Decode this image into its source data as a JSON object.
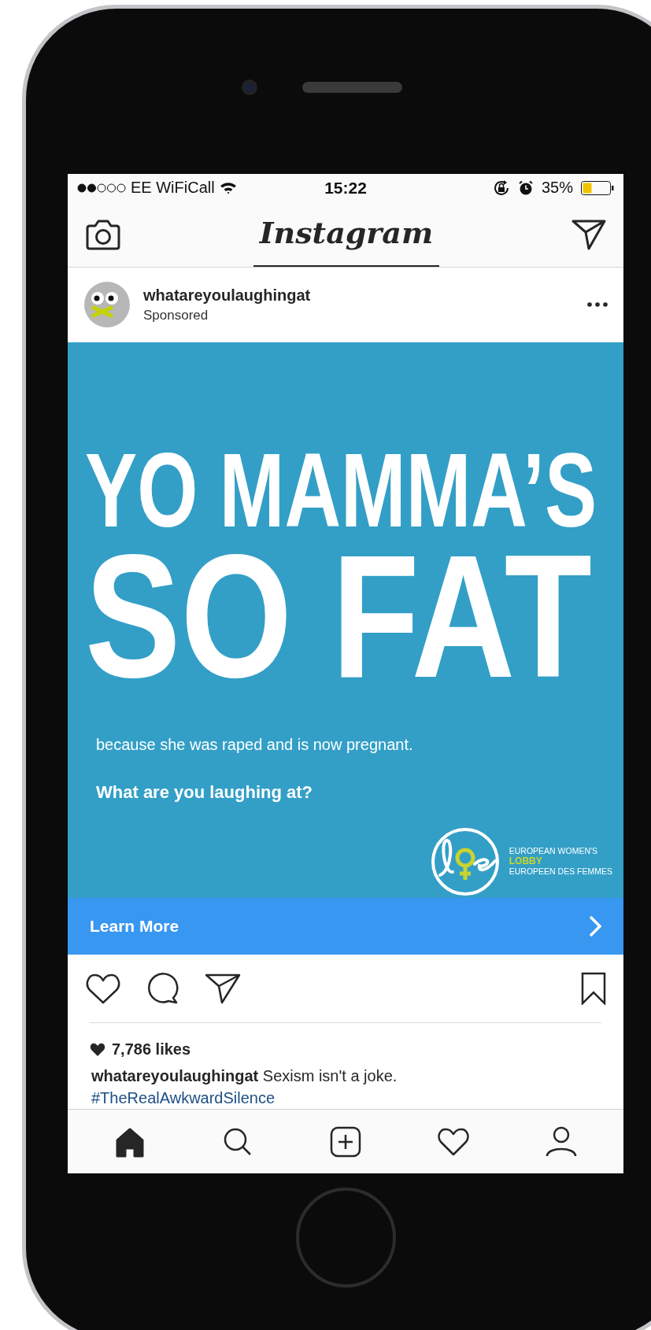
{
  "status_bar": {
    "carrier": "EE WiFiCall",
    "time": "15:22",
    "battery": "35%"
  },
  "header": {
    "logo": "Instagram"
  },
  "post": {
    "username": "whatareyoulaughingat",
    "subtitle": "Sponsored",
    "ad": {
      "headline_1": "YO MAMMA’S",
      "headline_2": "SO FAT",
      "body": "because she was raped and is now pregnant.",
      "question": "What are you laughing at?",
      "logo_lines": [
        {
          "text": "EUROPEAN WOMEN'S",
          "kind": "plain"
        },
        {
          "text": "LOBBY",
          "kind": "accent"
        },
        {
          "text": "EUROPEEN DES FEMMES",
          "kind": "plain"
        }
      ]
    },
    "cta": "Learn More",
    "likes": "7,786 likes",
    "caption": "**whatareyoulaughingat** Sexism isn't a joke.",
    "hashtag": "#TheRealAwkwardSilence"
  },
  "nav": [
    {
      "kind": "home",
      "selected": true
    },
    {
      "kind": "search",
      "selected": false
    },
    {
      "kind": "add",
      "selected": false
    },
    {
      "kind": "activity",
      "selected": false
    },
    {
      "kind": "profile",
      "selected": false
    }
  ]
}
